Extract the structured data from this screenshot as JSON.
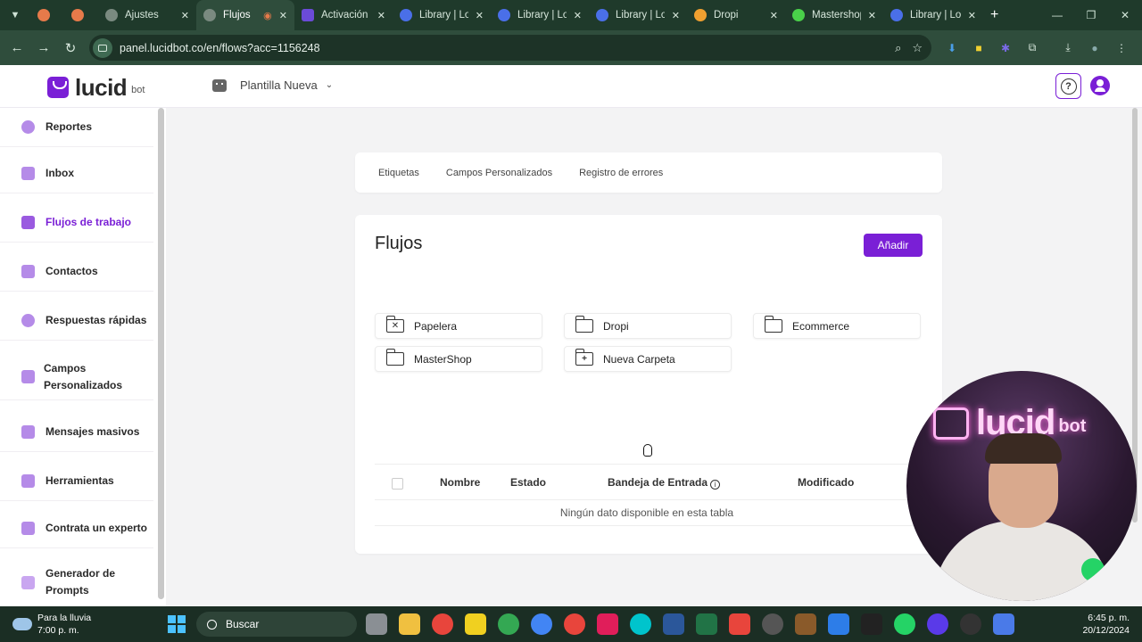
{
  "browser": {
    "tabs": [
      {
        "label": "",
        "fav_color": "#e67a4a"
      },
      {
        "label": "",
        "fav_color": "#e67a4a"
      },
      {
        "label": "Ajustes",
        "fav_color": "#7a8a80"
      },
      {
        "label": "Flujos",
        "fav_color": "#7a8a80",
        "active": true
      },
      {
        "label": "Activación",
        "fav_color": "#6b4bd8"
      },
      {
        "label": "Library | Lo",
        "fav_color": "#4a6fe8"
      },
      {
        "label": "Library | Lo",
        "fav_color": "#4a6fe8"
      },
      {
        "label": "Library | Lo",
        "fav_color": "#4a6fe8"
      },
      {
        "label": "Dropi",
        "fav_color": "#f0a030"
      },
      {
        "label": "Mastershop",
        "fav_color": "#4ad04a"
      },
      {
        "label": "Library | Lo",
        "fav_color": "#4a6fe8"
      }
    ],
    "url": "panel.lucidbot.co/en/flows?acc=1156248"
  },
  "header": {
    "logo_text": "lucid",
    "logo_sub": "bot",
    "template_name": "Plantilla Nueva"
  },
  "sidebar": {
    "items": [
      {
        "label": "Reportes"
      },
      {
        "label": "Inbox"
      },
      {
        "label": "Flujos de trabajo",
        "active": true
      },
      {
        "label": "Contactos"
      },
      {
        "label": "Respuestas rápidas"
      },
      {
        "label": "Campos Personalizados"
      },
      {
        "label": "Mensajes masivos"
      },
      {
        "label": "Herramientas"
      },
      {
        "label": "Contrata un experto"
      },
      {
        "label": "Generador de Prompts"
      }
    ]
  },
  "subnav": {
    "tabs": [
      "Etiquetas",
      "Campos Personalizados",
      "Registro de errores"
    ]
  },
  "flows": {
    "title": "Flujos",
    "add_label": "Añadir",
    "folders": [
      {
        "label": "Papelera",
        "icon": "trash-folder-icon"
      },
      {
        "label": "Dropi",
        "icon": "folder-icon"
      },
      {
        "label": "Ecommerce",
        "icon": "folder-icon"
      },
      {
        "label": "MasterShop",
        "icon": "folder-icon"
      },
      {
        "label": "Nueva Carpeta",
        "icon": "add-folder-icon"
      }
    ],
    "table": {
      "columns": [
        "Nombre",
        "Estado",
        "Bandeja de Entrada",
        "Modificado"
      ],
      "empty_text": "Ningún dato disponible en esta tabla"
    }
  },
  "webcam": {
    "neon_text": "lucid",
    "neon_sub": "bot"
  },
  "taskbar": {
    "weather_title": "Para la lluvia",
    "weather_sub": "7:00 p. m.",
    "search_label": "Buscar",
    "time": "6:45 p. m.",
    "date": "20/12/2024"
  },
  "colors": {
    "brand": "#7a1fd6",
    "chrome": "#2f4d3c"
  }
}
